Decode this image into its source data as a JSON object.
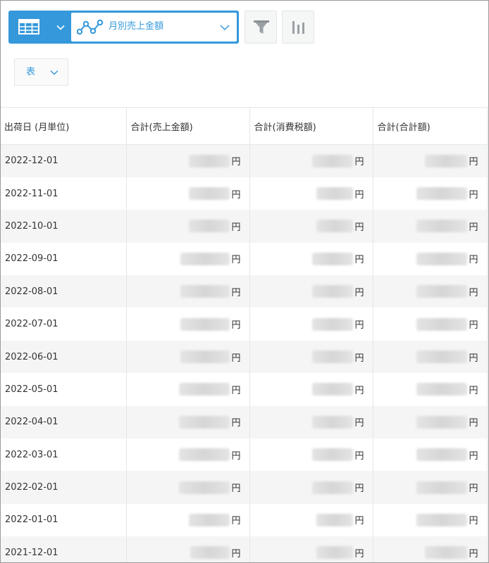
{
  "toolbar": {
    "view_type_icon": "table-grid-icon",
    "view_name": "月別売上金額",
    "filter_icon": "funnel-icon",
    "chart_icon": "bar-chart-icon",
    "accent_color": "#3498db",
    "table_type_label": "表"
  },
  "table": {
    "headers": [
      "出荷日 (月単位)",
      "合計(売上金額)",
      "合計(消費税額)",
      "合計(合計額)"
    ],
    "rows": [
      {
        "date": "2022-12-01",
        "unit": "円"
      },
      {
        "date": "2022-11-01",
        "unit": "円"
      },
      {
        "date": "2022-10-01",
        "unit": "円"
      },
      {
        "date": "2022-09-01",
        "unit": "円"
      },
      {
        "date": "2022-08-01",
        "unit": "円"
      },
      {
        "date": "2022-07-01",
        "unit": "円"
      },
      {
        "date": "2022-06-01",
        "unit": "円"
      },
      {
        "date": "2022-05-01",
        "unit": "円"
      },
      {
        "date": "2022-04-01",
        "unit": "円"
      },
      {
        "date": "2022-03-01",
        "unit": "円"
      },
      {
        "date": "2022-02-01",
        "unit": "円"
      },
      {
        "date": "2022-01-01",
        "unit": "円"
      },
      {
        "date": "2021-12-01",
        "unit": "円"
      }
    ]
  }
}
